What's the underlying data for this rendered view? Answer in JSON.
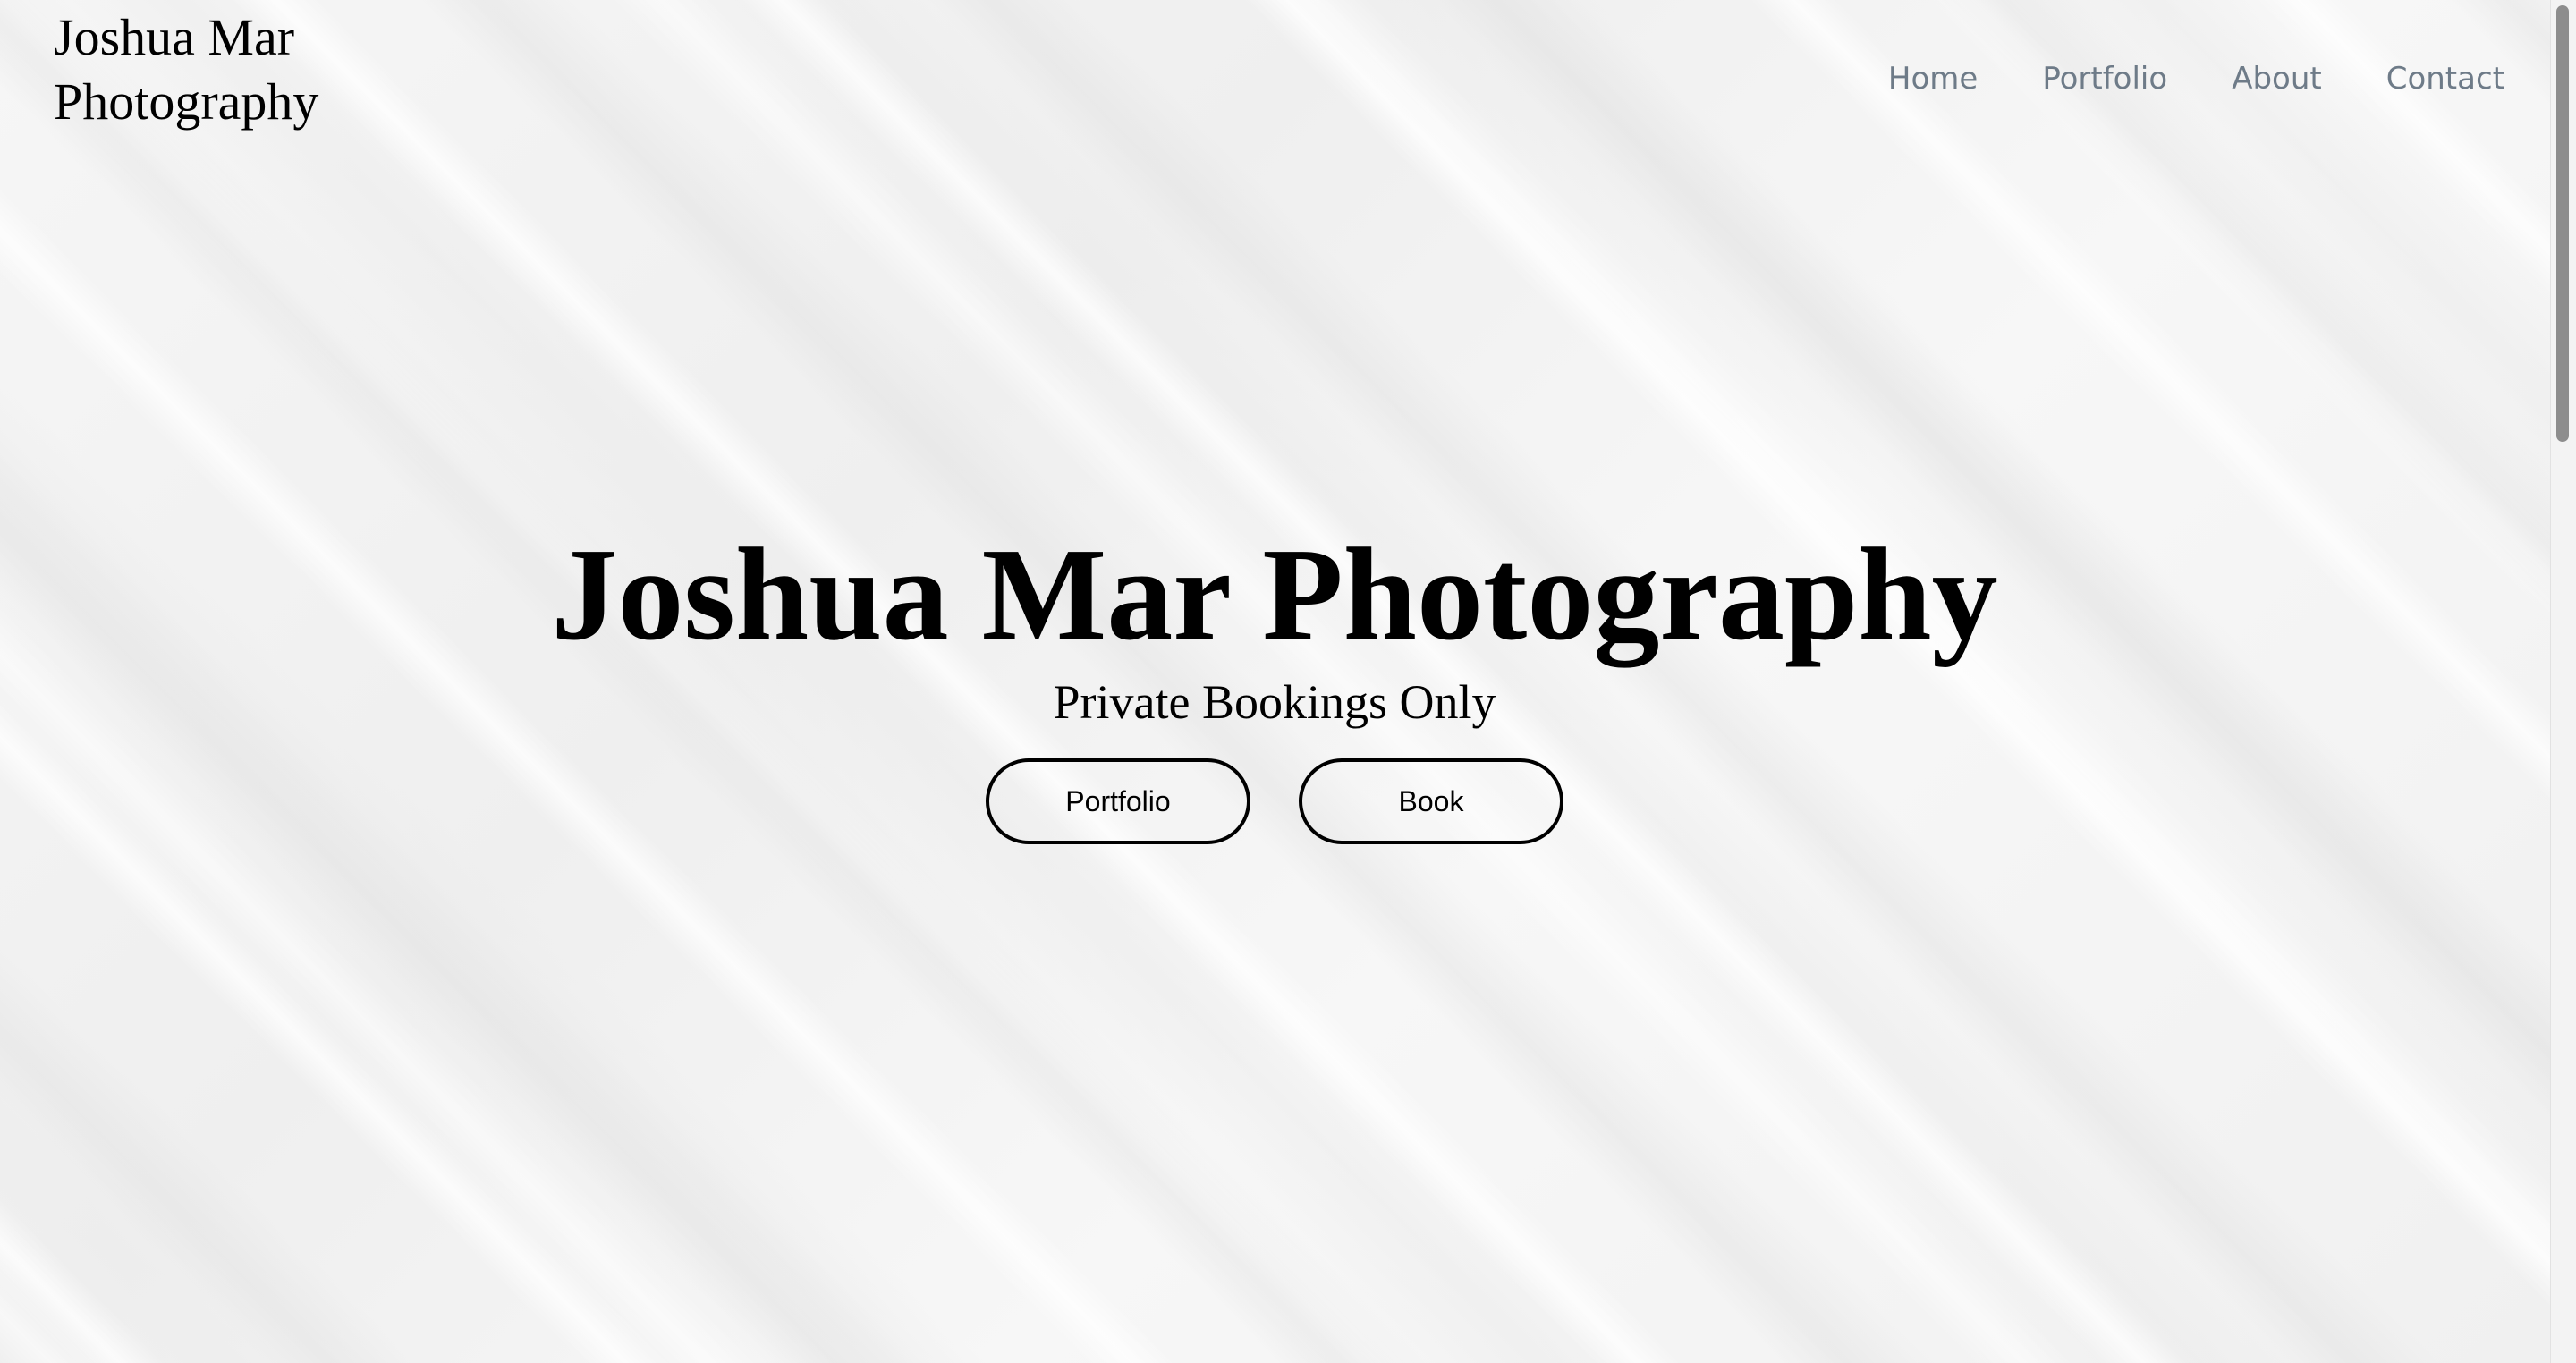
{
  "header": {
    "brand": "Joshua Mar Photography",
    "nav": [
      "Home",
      "Portfolio",
      "About",
      "Contact"
    ]
  },
  "hero": {
    "title": "Joshua Mar Photography",
    "subtitle": "Private Bookings Only",
    "buttons": [
      "Portfolio",
      "Book"
    ]
  },
  "colors": {
    "background": "#f2f2f2",
    "nav_link": "#6e7b88",
    "text": "#000000"
  }
}
